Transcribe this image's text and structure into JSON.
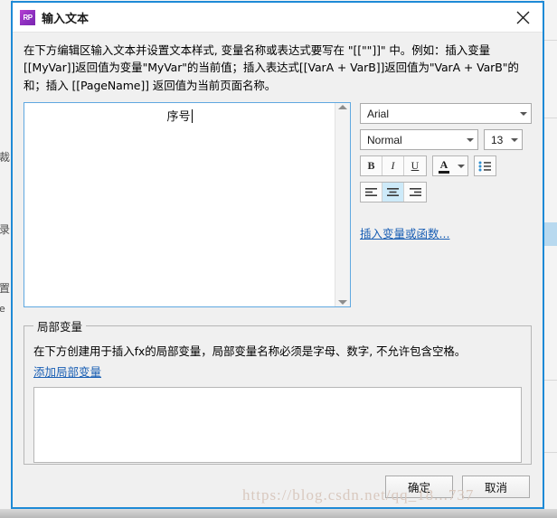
{
  "titlebar": {
    "icon_text": "RP",
    "title": "输入文本",
    "close_label": "×"
  },
  "description": "在下方编辑区输入文本并设置文本样式, 变量名称或表达式要写在 \"[[\"\"]]\" 中。例如：插入变量[[MyVar]]返回值为变量\"MyVar\"的当前值；插入表达式[[VarA + VarB]]返回值为\"VarA + VarB\"的和；插入 [[PageName]] 返回值为当前页面名称。",
  "editor": {
    "content": "序号",
    "scroll_up": "▲",
    "scroll_down": "▼"
  },
  "toolbox": {
    "font_family": "Arial",
    "font_style": "Normal",
    "font_size": "13",
    "bold_label": "B",
    "italic_label": "I",
    "underline_label": "U",
    "color_glyph": "A",
    "color_value": "#1a1a1a",
    "bullet_name": "bullet-list",
    "align_left": "align-left",
    "align_center": "align-center",
    "align_right": "align-right",
    "active_align": "align-center",
    "insert_link": "插入变量或函数..."
  },
  "local_vars": {
    "legend": "局部变量",
    "description": "在下方创建用于插入fx的局部变量，局部变量名称必须是字母、数字, 不允许包含空格。",
    "add_link": "添加局部变量",
    "list_items": []
  },
  "footer": {
    "ok_label": "确定",
    "cancel_label": "取消"
  },
  "watermark": "https://blog.csdn.net/qq_18...737",
  "background": {
    "ghost_chars": [
      "裁",
      "录",
      "置",
      "e"
    ]
  },
  "colors": {
    "dialog_border": "#1e8ad6",
    "accent_blue": "#1a5fb4",
    "selection_blue": "#cdeaf9",
    "icon_purple": "#8d2fbf"
  }
}
